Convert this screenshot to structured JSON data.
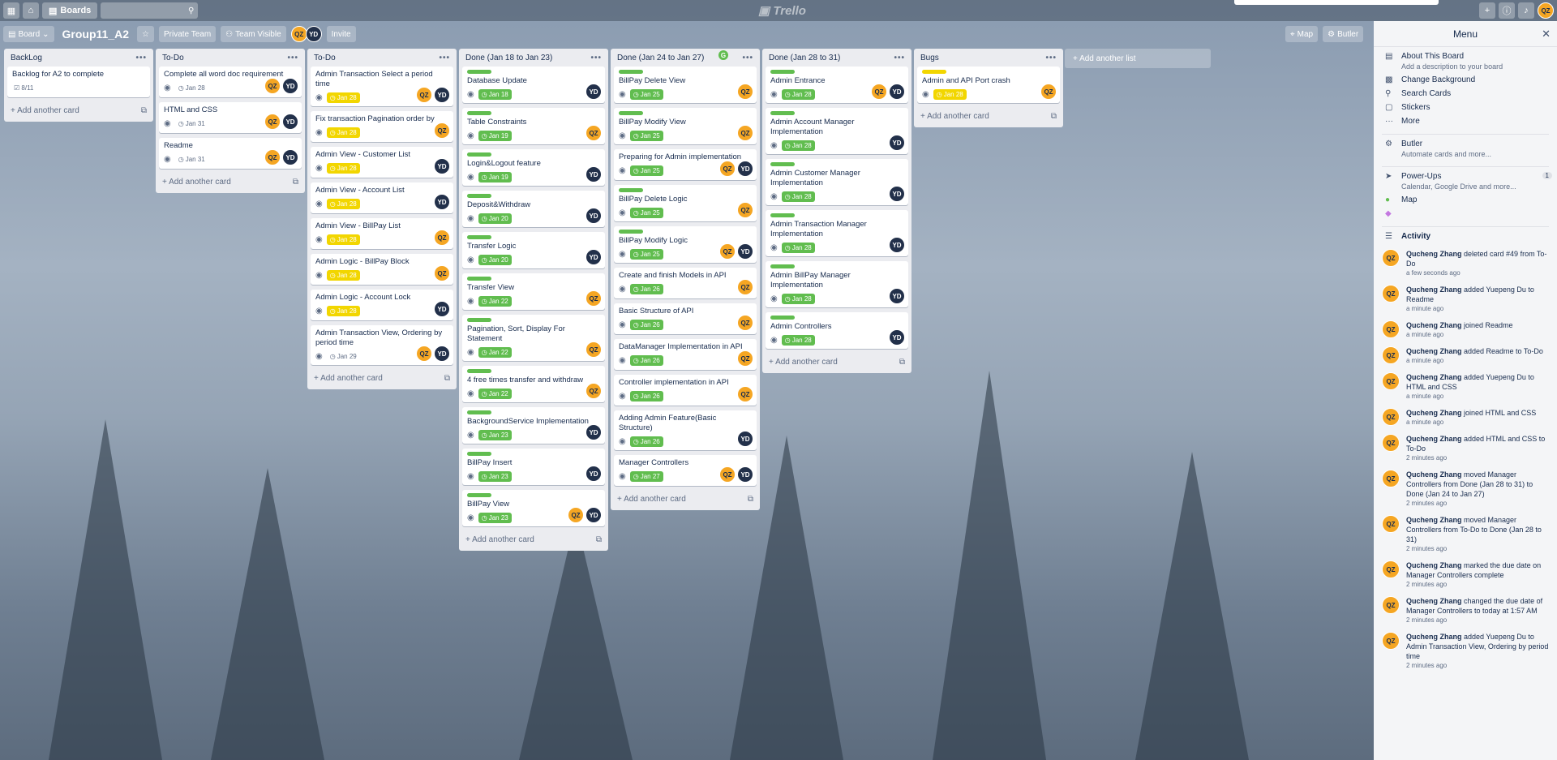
{
  "topbar": {
    "boards": "Boards",
    "logo": "Trello",
    "user": "QZ"
  },
  "board": {
    "view": "Board",
    "name": "Group11_A2",
    "team": "Private Team",
    "visibility": "Team Visible",
    "invite": "Invite",
    "members": [
      "QZ",
      "YD"
    ],
    "map": "Map",
    "butler": "Butler",
    "add_list": "+ Add another list"
  },
  "lists": [
    {
      "title": "BackLog",
      "add": "+ Add another card",
      "cards": [
        {
          "title": "Backlog for A2 to complete",
          "checklist": "8/11",
          "members": []
        }
      ]
    },
    {
      "title": "To-Do",
      "add": "+ Add another card",
      "cards": [
        {
          "title": "Complete all word doc requirement",
          "due": "Jan 28",
          "due_style": "plain",
          "members": [
            "QZ",
            "YD"
          ]
        },
        {
          "title": "HTML and CSS",
          "due": "Jan 31",
          "due_style": "plain",
          "members": [
            "QZ",
            "YD"
          ]
        },
        {
          "title": "Readme",
          "due": "Jan 31",
          "due_style": "plain",
          "members": [
            "QZ",
            "YD"
          ]
        }
      ]
    },
    {
      "title": "To-Do",
      "add": "+ Add another card",
      "cards": [
        {
          "title": "Admin Transaction Select a period time",
          "due": "Jan 28",
          "due_style": "yellow",
          "members": [
            "QZ",
            "YD"
          ]
        },
        {
          "title": "Fix transaction Pagination order by",
          "due": "Jan 28",
          "due_style": "yellow",
          "members": [
            "QZ"
          ]
        },
        {
          "title": "Admin View - Customer List",
          "due": "Jan 28",
          "due_style": "yellow",
          "members": [
            "YD"
          ]
        },
        {
          "title": "Admin View - Account List",
          "due": "Jan 28",
          "due_style": "yellow",
          "members": [
            "YD"
          ]
        },
        {
          "title": "Admin View - BillPay List",
          "due": "Jan 28",
          "due_style": "yellow",
          "members": [
            "QZ"
          ]
        },
        {
          "title": "Admin Logic - BillPay Block",
          "due": "Jan 28",
          "due_style": "yellow",
          "members": [
            "QZ"
          ]
        },
        {
          "title": "Admin Logic - Account Lock",
          "due": "Jan 28",
          "due_style": "yellow",
          "members": [
            "YD"
          ]
        },
        {
          "title": "Admin Transaction View, Ordering by period time",
          "due": "Jan 29",
          "due_style": "plain",
          "members": [
            "QZ",
            "YD"
          ]
        }
      ]
    },
    {
      "title": "Done (Jan 18 to Jan 23)",
      "add": "+ Add another card",
      "cards": [
        {
          "title": "Database Update",
          "due": "Jan 18",
          "due_style": "green",
          "label": "green",
          "members": [
            "YD"
          ]
        },
        {
          "title": "Table Constraints",
          "due": "Jan 19",
          "due_style": "green",
          "label": "green",
          "members": [
            "QZ"
          ]
        },
        {
          "title": "Login&Logout feature",
          "due": "Jan 19",
          "due_style": "green",
          "label": "green",
          "members": [
            "YD"
          ]
        },
        {
          "title": "Deposit&Withdraw",
          "due": "Jan 20",
          "due_style": "green",
          "label": "green",
          "members": [
            "YD"
          ]
        },
        {
          "title": "Transfer Logic",
          "due": "Jan 20",
          "due_style": "green",
          "label": "green",
          "members": [
            "YD"
          ]
        },
        {
          "title": "Transfer View",
          "due": "Jan 22",
          "due_style": "green",
          "label": "green",
          "members": [
            "QZ"
          ]
        },
        {
          "title": "Pagination, Sort, Display For Statement",
          "due": "Jan 22",
          "due_style": "green",
          "label": "green",
          "members": [
            "QZ"
          ]
        },
        {
          "title": "4 free times transfer and withdraw",
          "due": "Jan 22",
          "due_style": "green",
          "label": "green",
          "members": [
            "QZ"
          ]
        },
        {
          "title": "BackgroundService Implementation",
          "due": "Jan 23",
          "due_style": "green",
          "label": "green",
          "members": [
            "YD"
          ]
        },
        {
          "title": "BillPay Insert",
          "due": "Jan 23",
          "due_style": "green",
          "label": "green",
          "members": [
            "YD"
          ]
        },
        {
          "title": "BillPay View",
          "due": "Jan 23",
          "due_style": "green",
          "label": "green",
          "members": [
            "QZ",
            "YD"
          ]
        }
      ]
    },
    {
      "title": "Done (Jan 24 to Jan 27)",
      "add": "+ Add another card",
      "cards": [
        {
          "title": "BillPay Delete View",
          "due": "Jan 25",
          "due_style": "green",
          "label": "green",
          "members": [
            "QZ"
          ]
        },
        {
          "title": "BillPay Modify View",
          "due": "Jan 25",
          "due_style": "green",
          "label": "green",
          "members": [
            "QZ"
          ]
        },
        {
          "title": "Preparing for Admin implementation",
          "due": "Jan 25",
          "due_style": "green",
          "members": [
            "QZ",
            "YD"
          ]
        },
        {
          "title": "BillPay Delete Logic",
          "due": "Jan 25",
          "due_style": "green",
          "label": "green",
          "members": [
            "QZ"
          ]
        },
        {
          "title": "BillPay Modify Logic",
          "due": "Jan 25",
          "due_style": "green",
          "label": "green",
          "members": [
            "QZ",
            "YD"
          ]
        },
        {
          "title": "Create and finish Models in API",
          "due": "Jan 26",
          "due_style": "green",
          "members": [
            "QZ"
          ]
        },
        {
          "title": "Basic Structure of API",
          "due": "Jan 26",
          "due_style": "green",
          "members": [
            "QZ"
          ]
        },
        {
          "title": "DataManager Implementation in API",
          "due": "Jan 26",
          "due_style": "green",
          "members": [
            "QZ"
          ]
        },
        {
          "title": "Controller implementation in API",
          "due": "Jan 26",
          "due_style": "green",
          "members": [
            "QZ"
          ]
        },
        {
          "title": "Adding Admin Feature(Basic Structure)",
          "due": "Jan 26",
          "due_style": "green",
          "members": [
            "YD"
          ]
        },
        {
          "title": "Manager Controllers",
          "due": "Jan 27",
          "due_style": "green",
          "members": [
            "QZ",
            "YD"
          ]
        }
      ]
    },
    {
      "title": "Done (Jan 28 to 31)",
      "add": "+ Add another card",
      "cards": [
        {
          "title": "Admin Entrance",
          "due": "Jan 28",
          "due_style": "green",
          "label": "green",
          "members": [
            "QZ",
            "YD"
          ]
        },
        {
          "title": "Admin Account Manager Implementation",
          "due": "Jan 28",
          "due_style": "green",
          "label": "green",
          "members": [
            "YD"
          ]
        },
        {
          "title": "Admin Customer Manager Implementation",
          "due": "Jan 28",
          "due_style": "green",
          "label": "green",
          "members": [
            "YD"
          ]
        },
        {
          "title": "Admin Transaction Manager Implementation",
          "due": "Jan 28",
          "due_style": "green",
          "label": "green",
          "members": [
            "YD"
          ]
        },
        {
          "title": "Admin BillPay Manager Implementation",
          "due": "Jan 28",
          "due_style": "green",
          "label": "green",
          "members": [
            "YD"
          ]
        },
        {
          "title": "Admin Controllers",
          "due": "Jan 28",
          "due_style": "green",
          "label": "green",
          "members": [
            "YD"
          ]
        }
      ]
    },
    {
      "title": "Bugs",
      "add": "+ Add another card",
      "cards": [
        {
          "title": "Admin and API Port crash",
          "due": "Jan 28",
          "due_style": "yellow",
          "label": "yellow",
          "members": [
            "QZ"
          ]
        }
      ]
    }
  ],
  "colors": {
    "green": "#61bd4f",
    "yellow": "#f2d600",
    "qz": "#f5a623",
    "yd": "#22304a"
  },
  "menu": {
    "title": "Menu",
    "items": [
      {
        "icon": "board-icon",
        "title": "About This Board",
        "sub": "Add a description to your board"
      },
      {
        "icon": "background-icon",
        "title": "Change Background",
        "sub": ""
      },
      {
        "icon": "search-icon",
        "title": "Search Cards",
        "sub": ""
      },
      {
        "icon": "sticker-icon",
        "title": "Stickers",
        "sub": ""
      },
      {
        "icon": "more-icon",
        "title": "More",
        "sub": ""
      }
    ],
    "butler": {
      "title": "Butler",
      "sub": "Automate cards and more..."
    },
    "powerups": {
      "title": "Power-Ups",
      "sub": "Calendar, Google Drive and more...",
      "count": "1"
    },
    "map": "Map",
    "activity_title": "Activity",
    "activity": [
      {
        "user": "Qucheng Zhang",
        "text": "deleted card #49 from To-Do",
        "time": "a few seconds ago"
      },
      {
        "user": "Qucheng Zhang",
        "text": "added Yuepeng Du to Readme",
        "time": "a minute ago"
      },
      {
        "user": "Qucheng Zhang",
        "text": "joined Readme",
        "time": "a minute ago"
      },
      {
        "user": "Qucheng Zhang",
        "text": "added Readme to To-Do",
        "time": "a minute ago"
      },
      {
        "user": "Qucheng Zhang",
        "text": "added Yuepeng Du to HTML and CSS",
        "time": "a minute ago"
      },
      {
        "user": "Qucheng Zhang",
        "text": "joined HTML and CSS",
        "time": "a minute ago"
      },
      {
        "user": "Qucheng Zhang",
        "text": "added HTML and CSS to To-Do",
        "time": "2 minutes ago"
      },
      {
        "user": "Qucheng Zhang",
        "text": "moved Manager Controllers from Done (Jan 28 to 31) to Done (Jan 24 to Jan 27)",
        "time": "2 minutes ago"
      },
      {
        "user": "Qucheng Zhang",
        "text": "moved Manager Controllers from To-Do to Done (Jan 28 to 31)",
        "time": "2 minutes ago"
      },
      {
        "user": "Qucheng Zhang",
        "text": "marked the due date on Manager Controllers complete",
        "time": "2 minutes ago"
      },
      {
        "user": "Qucheng Zhang",
        "text": "changed the due date of Manager Controllers to today at 1:57 AM",
        "time": "2 minutes ago"
      },
      {
        "user": "Qucheng Zhang",
        "text": "added Yuepeng Du to Admin Transaction View, Ordering by period time",
        "time": "2 minutes ago"
      }
    ]
  }
}
